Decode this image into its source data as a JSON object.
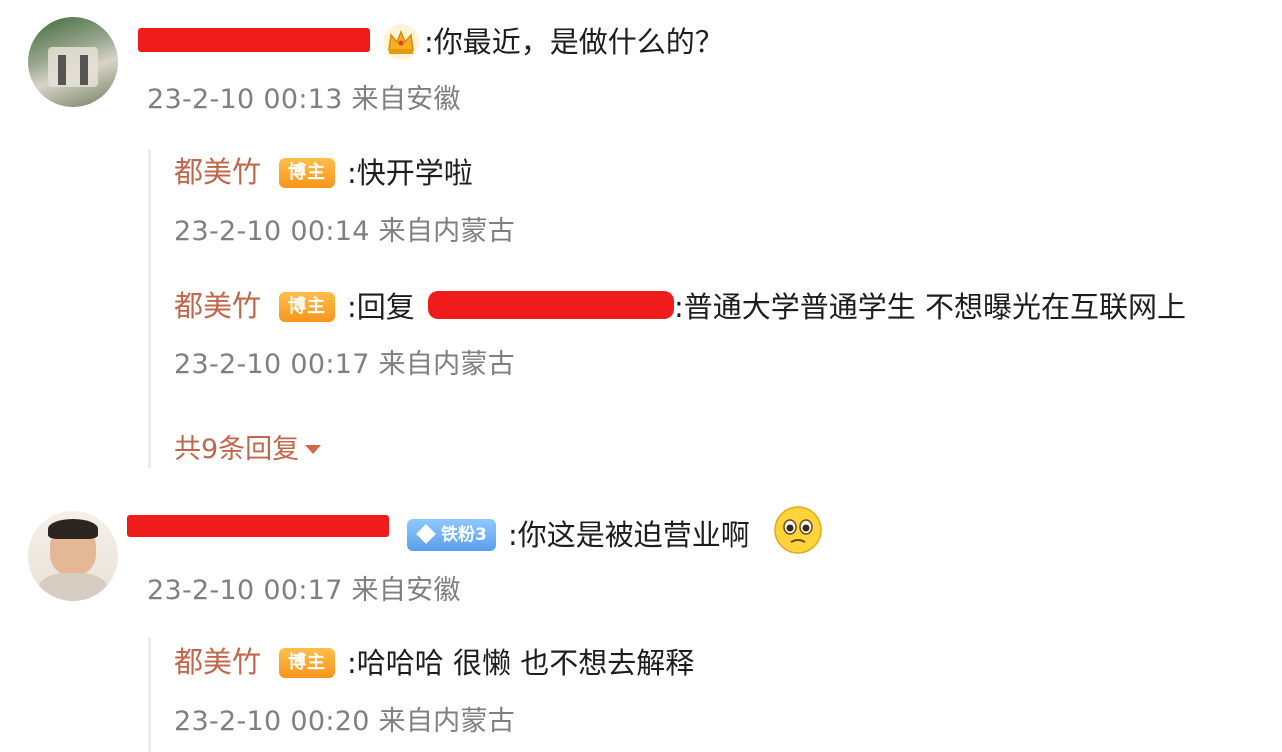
{
  "comments": [
    {
      "text": ":你最近，是做什么的？",
      "meta": "23-2-10 00:13 来自安徽",
      "replies": [
        {
          "author": "都美竹",
          "badge": "博主",
          "text": ":快开学啦",
          "meta": "23-2-10 00:14 来自内蒙古"
        },
        {
          "author": "都美竹",
          "badge": "博主",
          "text_prefix": ":回复",
          "text": ":普通大学普通学生 不想曝光在互联网上",
          "meta": "23-2-10 00:17 来自内蒙古"
        }
      ],
      "reply_count": "共9条回复"
    },
    {
      "fan_badge": "铁粉3",
      "text": ":你这是被迫营业啊",
      "emoji": "tearful-face-icon",
      "meta": "23-2-10 00:17 来自安徽",
      "replies": [
        {
          "author": "都美竹",
          "badge": "博主",
          "text": ":哈哈哈 很懒 也不想去解释",
          "meta": "23-2-10 00:20 来自内蒙古"
        }
      ]
    }
  ],
  "colors": {
    "author": "#c0674b",
    "meta": "#7f7f7f",
    "redaction": "#f01c1c",
    "blogger_badge": "#f6961a",
    "fan_badge": "#5b9eea"
  }
}
